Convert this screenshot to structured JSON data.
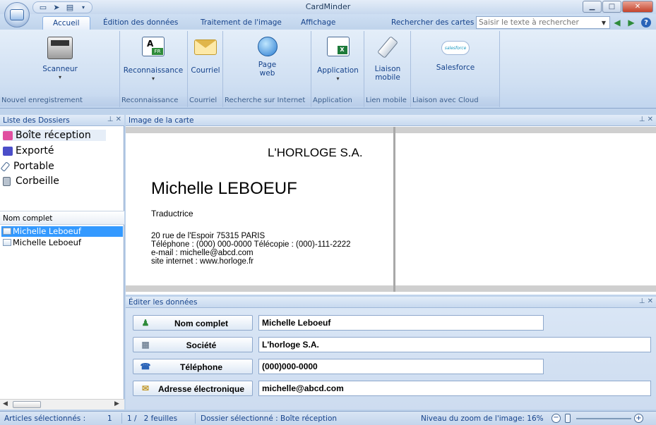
{
  "app": {
    "title": "CardMinder"
  },
  "tabs": [
    "Accueil",
    "Édition des données",
    "Traitement de l'image",
    "Affichage"
  ],
  "search": {
    "label": "Rechercher des cartes :",
    "placeholder": "Saisir le texte à rechercher"
  },
  "ribbon": {
    "groups": [
      {
        "label": "Nouvel enregistrement",
        "buttons": [
          "Scanneur"
        ]
      },
      {
        "label": "Reconnaissance",
        "buttons": [
          "Reconnaissance"
        ]
      },
      {
        "label": "Courriel",
        "buttons": [
          "Courriel"
        ]
      },
      {
        "label": "Recherche sur Internet",
        "buttons": [
          "Page web"
        ]
      },
      {
        "label": "Application",
        "buttons": [
          "Application"
        ]
      },
      {
        "label": "Lien mobile",
        "buttons": [
          "Liaison mobile"
        ]
      },
      {
        "label": "Liaison avec Cloud",
        "buttons": [
          "Salesforce"
        ]
      }
    ],
    "salesforce_logo": "salesforce"
  },
  "folders_panel": {
    "title": "Liste des Dossiers",
    "folders": [
      "Boîte réception",
      "Exporté",
      "Portable",
      "Corbeille"
    ],
    "column_header": "Nom complet",
    "records": [
      "Michelle Leboeuf",
      "Michelle Leboeuf"
    ]
  },
  "image_panel": {
    "title": "Image de la carte"
  },
  "card": {
    "company": "L'HORLOGE S.A.",
    "name": "Michelle LEBOEUF",
    "job": "Traductrice",
    "address": "20 rue de l'Espoir 75315 PARIS",
    "phone_line": "Téléphone : (000) 000-0000    Télécopie : (000)-111-2222",
    "email_line": "e-mail : michelle@abcd.com",
    "web_line": "site internet : www.horloge.fr"
  },
  "edit_panel": {
    "title": "Éditer les données",
    "fields": [
      {
        "label": "Nom complet",
        "value": "Michelle Leboeuf"
      },
      {
        "label": "Société",
        "value": "L'horloge S.A."
      },
      {
        "label": "Téléphone",
        "value": "(000)000-0000"
      },
      {
        "label": "Adresse électronique",
        "value": "michelle@abcd.com"
      }
    ]
  },
  "status": {
    "selected": "Articles sélectionnés :",
    "selected_count": "1",
    "pages": "1 /   2 feuilles",
    "folder": "Dossier sélectionné : Boîte réception",
    "zoom_label": "Niveau du zoom de l'image: 16%"
  },
  "colors": {
    "accent": "#15428b",
    "selection": "#3399ff",
    "ribbon": "#cfdff2"
  }
}
